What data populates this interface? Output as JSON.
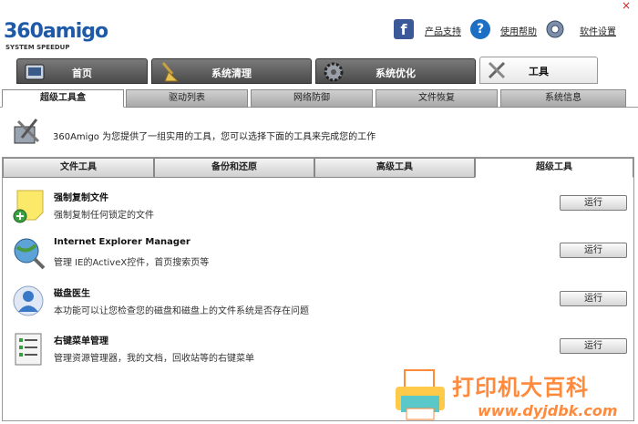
{
  "window": {
    "close_glyph": "×"
  },
  "logo": {
    "main": "360amigo",
    "sub": "SYSTEM SPEEDUP"
  },
  "header_links": {
    "product_support": "产品支持",
    "help": "使用帮助",
    "settings": "软件设置"
  },
  "main_tabs": [
    {
      "label": "首页",
      "icon": "home-icon"
    },
    {
      "label": "系统清理",
      "icon": "broom-icon"
    },
    {
      "label": "系统优化",
      "icon": "gear-icon"
    },
    {
      "label": "工具",
      "icon": "tools-icon",
      "active": true
    }
  ],
  "sub_tabs": [
    {
      "label": "超级工具盒",
      "active": true
    },
    {
      "label": "驱动列表"
    },
    {
      "label": "网络防御"
    },
    {
      "label": "文件恢复"
    },
    {
      "label": "系统信息"
    }
  ],
  "info": {
    "text": "360Amigo 为您提供了一组实用的工具，您可以选择下面的工具来完成您的工作"
  },
  "tool_categories": [
    {
      "label": "文件工具"
    },
    {
      "label": "备份和还原"
    },
    {
      "label": "高级工具"
    },
    {
      "label": "超级工具",
      "active": true
    }
  ],
  "tools": [
    {
      "name": "强制复制文件",
      "desc": "强制复制任何锁定的文件",
      "run": "运行",
      "icon": "sticky-note-add-icon"
    },
    {
      "name": "Internet Explorer Manager",
      "desc": "管理 IE的ActiveX控件，首页搜索页等",
      "run": "运行",
      "icon": "globe-search-icon"
    },
    {
      "name": "磁盘医生",
      "desc": "本功能可以让您检查您的磁盘和磁盘上的文件系统是否存在问题",
      "run": "运行",
      "icon": "user-disk-icon"
    },
    {
      "name": "右键菜单管理",
      "desc": "管理资源管理器，我的文档，回收站等的右键菜单",
      "run": "运行",
      "icon": "list-menu-icon"
    }
  ],
  "watermark": {
    "text": "打印机大百科",
    "url": "www.dyjdbk.com"
  },
  "colors": {
    "brand": "#1e5aa8",
    "watermark": "#ff8a3c",
    "tab_dark": "#4a4a4a"
  }
}
